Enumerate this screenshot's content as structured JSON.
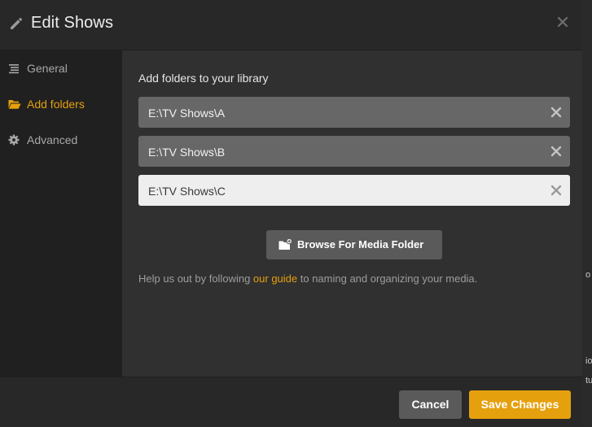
{
  "modal": {
    "title": "Edit Shows",
    "header_icon": "pencil-icon",
    "close_icon": "close-icon"
  },
  "sidebar": {
    "items": [
      {
        "label": "General",
        "icon": "list-icon",
        "active": false
      },
      {
        "label": "Add folders",
        "icon": "folder-open-icon",
        "active": true
      },
      {
        "label": "Advanced",
        "icon": "gear-icon",
        "active": false
      }
    ]
  },
  "content": {
    "heading": "Add folders to your library",
    "folders": [
      {
        "path": "E:\\TV Shows\\A",
        "state": "filled"
      },
      {
        "path": "E:\\TV Shows\\B",
        "state": "filled"
      },
      {
        "path": "E:\\TV Shows\\C",
        "state": "editing"
      }
    ],
    "browse_button": {
      "label": "Browse For Media Folder",
      "icon": "folder-add-icon"
    },
    "help": {
      "before": "Help us out by following ",
      "link": "our guide",
      "after": " to naming and organizing your media."
    }
  },
  "footer": {
    "cancel_label": "Cancel",
    "save_label": "Save Changes"
  },
  "colors": {
    "accent": "#e5a00d",
    "modal_bg": "#282828",
    "sidebar_bg": "#202020",
    "content_bg": "#303030"
  },
  "background": {
    "edge_text": [
      "o",
      "io",
      "tu"
    ]
  }
}
